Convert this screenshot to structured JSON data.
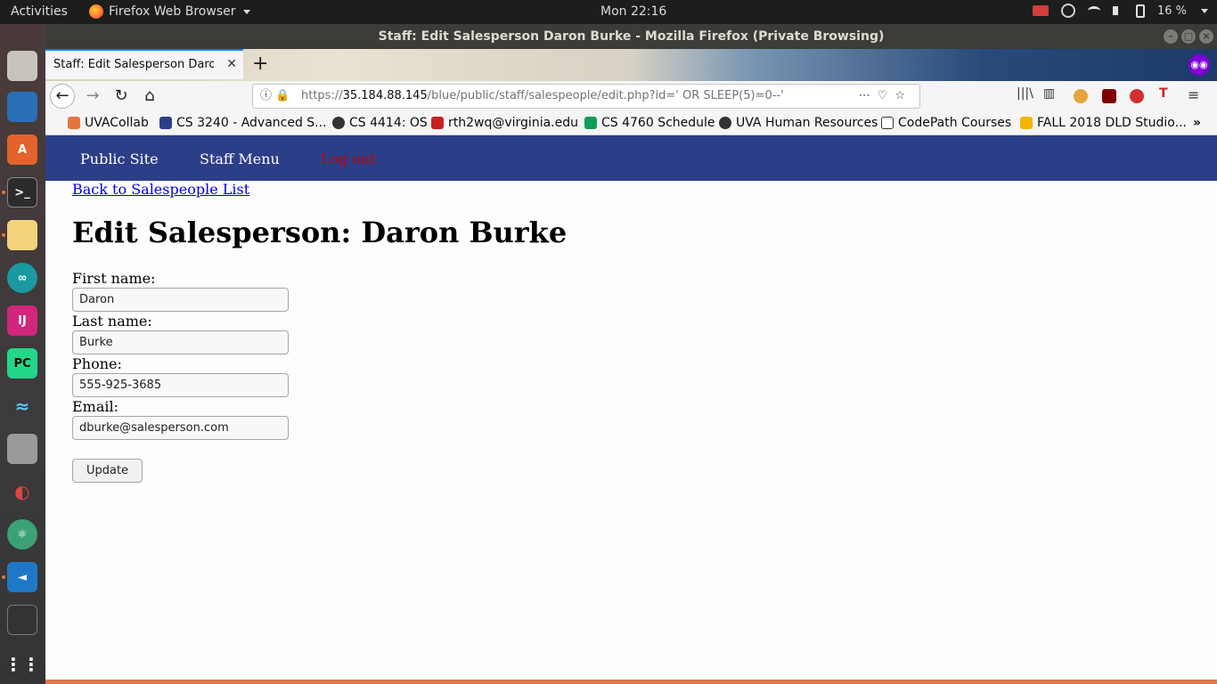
{
  "system": {
    "activities": "Activities",
    "app_menu": "Firefox Web Browser",
    "clock": "Mon 22:16",
    "battery": "16 %"
  },
  "window": {
    "title": "Staff: Edit Salesperson Daron Burke - Mozilla Firefox (Private Browsing)"
  },
  "tab": {
    "title": "Staff: Edit Salesperson Daron Burke"
  },
  "urlbar": {
    "prefix": "https://",
    "host": "35.184.88.145",
    "path": "/blue/public/staff/salespeople/edit.php?id=' OR SLEEP(5)=0--'"
  },
  "bookmarks": [
    {
      "label": "UVACollab",
      "color": "#e8743b"
    },
    {
      "label": "CS 3240 - Advanced S...",
      "color": "#2d3e88"
    },
    {
      "label": "CS 4414: OS",
      "color": "#333333"
    },
    {
      "label": "rth2wq@virginia.edu",
      "color": "#c5221f"
    },
    {
      "label": "CS 4760 Schedule",
      "color": "#0f9d58"
    },
    {
      "label": "UVA Human Resources",
      "color": "#333333"
    },
    {
      "label": "CodePath Courses",
      "color": "#333333"
    },
    {
      "label": "FALL 2018 DLD Studio...",
      "color": "#f4b400"
    }
  ],
  "site_nav": {
    "public_site": "Public Site",
    "staff_menu": "Staff Menu",
    "logout": "Log out"
  },
  "page": {
    "back_link": "Back to Salespeople List",
    "heading": "Edit Salesperson: Daron Burke",
    "first_name_label": "First name:",
    "first_name_value": "Daron",
    "last_name_label": "Last name:",
    "last_name_value": "Burke",
    "phone_label": "Phone:",
    "phone_value": "555-925-3685",
    "email_label": "Email:",
    "email_value": "dburke@salesperson.com",
    "update_button": "Update"
  }
}
